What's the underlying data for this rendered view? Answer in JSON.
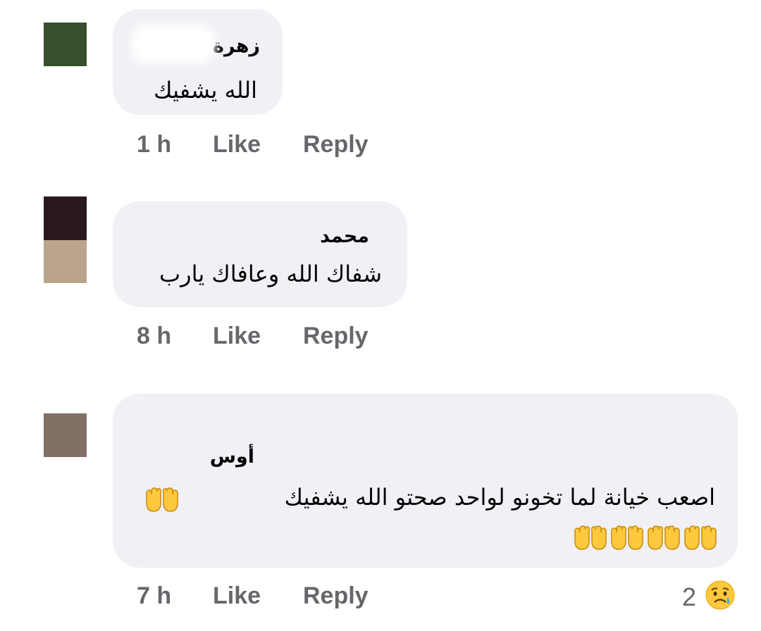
{
  "comments": [
    {
      "avatar_colors": [
        "#37502b"
      ],
      "author": "زهرة",
      "text": "الله يشفيك",
      "time": "1 h",
      "like_label": "Like",
      "reply_label": "Reply"
    },
    {
      "avatar_colors": [
        "#2b181c",
        "#bba48c"
      ],
      "author": "محمد",
      "text": "شفاك الله وعافاك يارب",
      "time": "8 h",
      "like_label": "Like",
      "reply_label": "Reply"
    },
    {
      "avatar_colors": [
        "#827066"
      ],
      "author": "أوس",
      "text": "اصعب خيانة لما تخونو لواحد صحتو الله يشفيك",
      "emoji": [
        "raising-hands"
      ],
      "emoji_line2": [
        "raising-hands",
        "raising-hands",
        "raising-hands",
        "raising-hands"
      ],
      "time": "7 h",
      "like_label": "Like",
      "reply_label": "Reply",
      "reaction_count": "2",
      "reaction_icon": "sad-face-icon"
    }
  ],
  "colors": {
    "bubble": "#f0f0f5",
    "meta_text": "#65676b",
    "emoji_yellow": "#ffc83d"
  }
}
